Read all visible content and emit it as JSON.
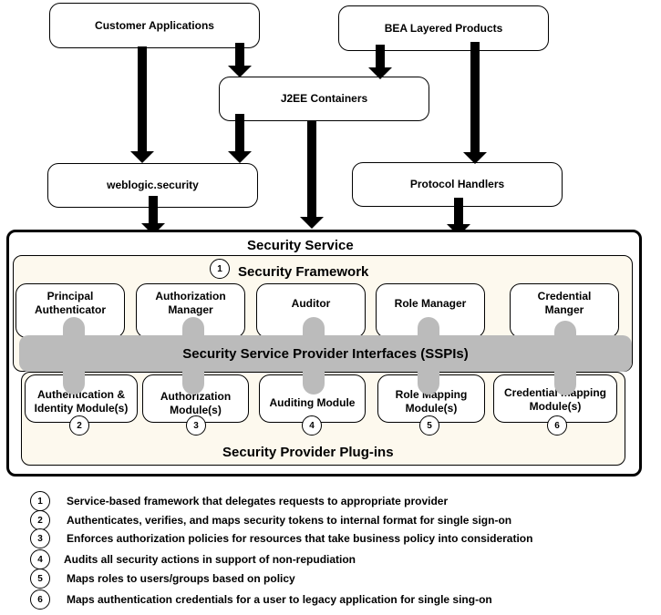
{
  "top_boxes": {
    "customer_applications": "Customer Applications",
    "bea_layered_products": "BEA Layered Products",
    "j2ee_containers": "J2EE Containers",
    "weblogic_security": "weblogic.security",
    "protocol_handlers": "Protocol Handlers"
  },
  "security_service": {
    "title": "Security Service",
    "framework_title": "Security Framework",
    "framework_number": "1",
    "managers": [
      "Principal Authenticator",
      "Authorization Manager",
      "Auditor",
      "Role Manager",
      "Credential Manger"
    ],
    "sspi_label": "Security Service Provider Interfaces (SSPIs)",
    "plugins_title": "Security Provider Plug-ins",
    "modules": [
      {
        "label": "Authentication & Identity Module(s)",
        "number": "2"
      },
      {
        "label": "Authorization Module(s)",
        "number": "3"
      },
      {
        "label": "Auditing Module",
        "number": "4"
      },
      {
        "label": "Role Mapping Module(s)",
        "number": "5"
      },
      {
        "label": "Credential mapping Module(s)",
        "number": "6"
      }
    ]
  },
  "legend": [
    {
      "number": "1",
      "text": "Service-based framework that delegates requests to appropriate provider"
    },
    {
      "number": "2",
      "text": "Authenticates, verifies, and maps security tokens to internal format for single sign-on"
    },
    {
      "number": "3",
      "text": "Enforces authorization policies for resources that take business policy into consideration"
    },
    {
      "number": "4",
      "text": "Audits all security actions in support of non-repudiation"
    },
    {
      "number": "5",
      "text": "Maps roles to users/groups based on policy"
    },
    {
      "number": "6",
      "text": "Maps authentication credentials for a user to legacy application for single sing-on"
    }
  ]
}
